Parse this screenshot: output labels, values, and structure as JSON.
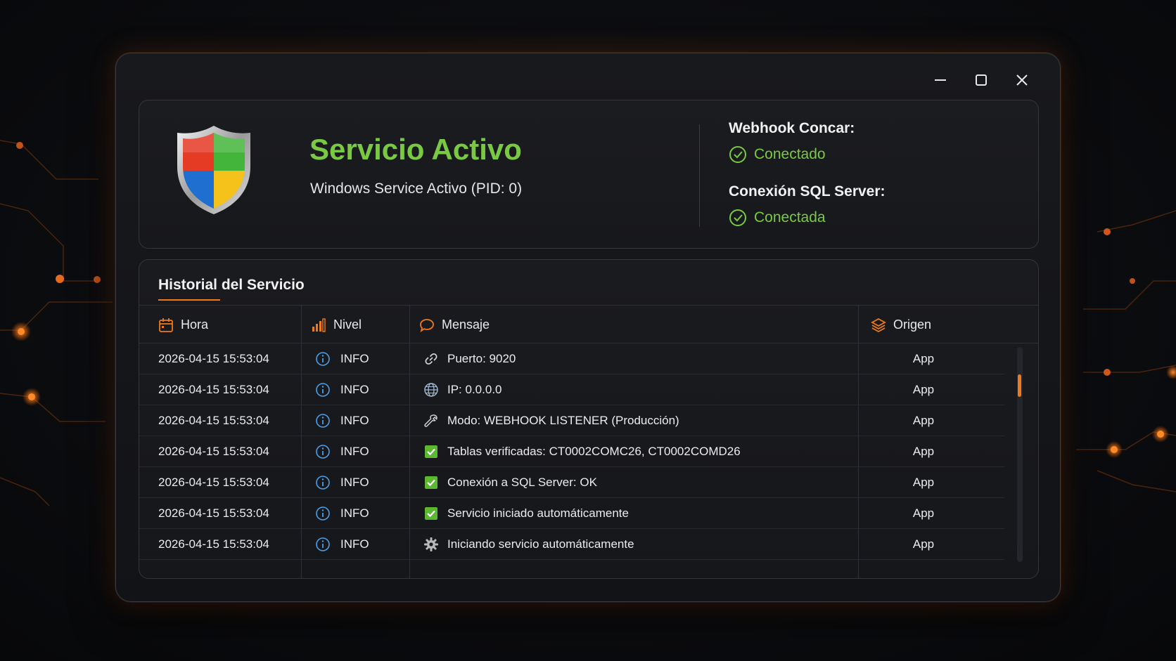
{
  "window": {
    "controls": [
      "minimize-icon",
      "maximize-icon",
      "close-icon"
    ]
  },
  "status": {
    "title": "Servicio Activo",
    "subtitle": "Windows Service Activo (PID: 0)",
    "icon": "shield-icon",
    "connections": [
      {
        "label": "Webhook Concar:",
        "value": "Conectado",
        "icon": "check-circle-icon"
      },
      {
        "label": "Conexión SQL Server:",
        "value": "Conectada",
        "icon": "check-circle-icon"
      }
    ]
  },
  "history": {
    "title": "Historial del Servicio",
    "columns": [
      {
        "label": "Hora",
        "icon": "calendar-icon"
      },
      {
        "label": "Nivel",
        "icon": "bar-chart-icon"
      },
      {
        "label": "Mensaje",
        "icon": "chat-bubble-icon"
      },
      {
        "label": "Origen",
        "icon": "layers-icon"
      }
    ],
    "rows": [
      {
        "time": "2026-04-15 15:53:04",
        "level": "INFO",
        "message": "Puerto: 9020",
        "msg_icon": "link-icon",
        "origin": "App"
      },
      {
        "time": "2026-04-15 15:53:04",
        "level": "INFO",
        "message": "IP: 0.0.0.0",
        "msg_icon": "globe-icon",
        "origin": "App"
      },
      {
        "time": "2026-04-15 15:53:04",
        "level": "INFO",
        "message": "Modo: WEBHOOK LISTENER (Producción)",
        "msg_icon": "wrench-icon",
        "origin": "App"
      },
      {
        "time": "2026-04-15 15:53:04",
        "level": "INFO",
        "message": "Tablas verificadas: CT0002COMC26, CT0002COMD26",
        "msg_icon": "checkbox-icon",
        "origin": "App"
      },
      {
        "time": "2026-04-15 15:53:04",
        "level": "INFO",
        "message": "Conexión a SQL Server: OK",
        "msg_icon": "checkbox-icon",
        "origin": "App"
      },
      {
        "time": "2026-04-15 15:53:04",
        "level": "INFO",
        "message": "Servicio iniciado automáticamente",
        "msg_icon": "checkbox-icon",
        "origin": "App"
      },
      {
        "time": "2026-04-15 15:53:04",
        "level": "INFO",
        "message": "Iniciando servicio automáticamente",
        "msg_icon": "gear-icon",
        "origin": "App"
      }
    ]
  },
  "colors": {
    "accent": "#f07a1a",
    "success": "#7ac943",
    "info": "#4a9fe8"
  }
}
